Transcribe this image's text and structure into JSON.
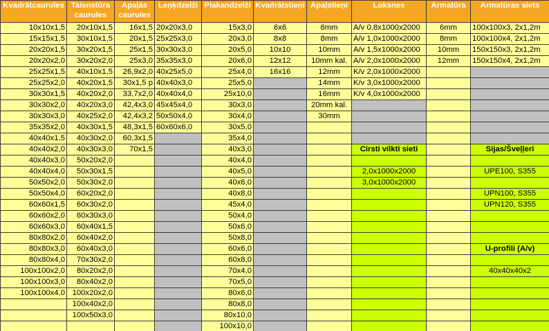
{
  "headers": [
    "Kvadrātcaurules",
    "Taisnstūra caurules",
    "Apaļās caurules",
    "Leņķdzelži",
    "Plakandzelži",
    "Kvadrātstieņi",
    "Apaļstieņi",
    "Loksnes",
    "Armatūra",
    "Armatūras siets"
  ],
  "colors": {
    "header": "#f5a623",
    "cell": "#ffff99",
    "empty": "#c0c0c0",
    "highlight": "#ccff00"
  },
  "rows": [
    [
      "10x10x1,5",
      "20x10x1,5",
      "16x1,5",
      "20x20x3,0",
      "15x3,0",
      "6x6",
      "6mm",
      "A/v 0,8x1000x2000",
      "6mm",
      "100x100x3, 2x1,2m"
    ],
    [
      "15x15x1,5",
      "30x10x1,5",
      "20x1,5",
      "25x25x3,0",
      "20x3,0",
      "8x8",
      "8mm",
      "A/v 1,0x1000x2000",
      "8mm",
      "100x100x4, 2x1,2m"
    ],
    [
      "20x20x1,5",
      "30x20x1,5",
      "25x1,5",
      "30x30x3,0",
      "20x5,0",
      "10x10",
      "10mm",
      "A/v 1,5x1000x2000",
      "10mm",
      "150x150x3, 2x1,2m"
    ],
    [
      "20x20x2,0",
      "30x20x2,0",
      "25x3,0",
      "35x35x3,0",
      "20x6,0",
      "12x12",
      "10mm kal.",
      "A/v 2,0x1000x2000",
      "12mm",
      "150x150x4, 2x1,2m"
    ],
    [
      "25x25x1,5",
      "40x10x1,5",
      "26,9x2,0",
      "40x25x5,0",
      "25x4,0",
      "16x16",
      "12mm",
      "K/v 2,0x1000x2000",
      "",
      ""
    ],
    [
      "25x25x2,0",
      "40x20x1,5",
      "30x1,5 p",
      "40x40x3,0",
      "25x5,0",
      "",
      "14mm",
      "K/v 3,0x1000x2000",
      "",
      ""
    ],
    [
      "30x30x1,5",
      "40x20x2,0",
      "33,7x2,0",
      "40x40x4,0",
      "25x10,0",
      "",
      "16mm",
      "K/v 4,0x1000x2000",
      "",
      ""
    ],
    [
      "30x30x2,0",
      "40x20x3,0",
      "42,4x3,0",
      "45x45x4,0",
      "30x3,0",
      "",
      "20mm kal.",
      "",
      "",
      ""
    ],
    [
      "30x30x3,0",
      "40x25x2,0",
      "42,4x3,2",
      "50x50x4,0",
      "30x4,0",
      "",
      "30mm",
      "",
      "",
      ""
    ],
    [
      "35x35x2,0",
      "40x30x1,5",
      "48,3x1,5",
      "60x60x6,0",
      "30x5,0",
      "",
      "",
      "",
      "",
      ""
    ],
    [
      "40x40x1,5",
      "40x30x2,0",
      "60,3x1,5",
      "",
      "35x4,0",
      "",
      "",
      "",
      "",
      ""
    ],
    [
      "40x40x2,0",
      "40x30x3,0",
      "70x1,5",
      "",
      "40x3,0",
      "",
      "",
      "Cirsti vilkti sieti",
      "",
      "Sijas/Šveļļeri"
    ],
    [
      "40x40x3,0",
      "50x20x2,0",
      "",
      "",
      "40x4,0",
      "",
      "",
      "",
      "",
      ""
    ],
    [
      "40x40x4,0",
      "50x30x1,5",
      "",
      "",
      "40x5,0",
      "",
      "",
      "2,0x1000x2000",
      "",
      "UPE100, S355"
    ],
    [
      "50x50x2,0",
      "50x30x2,0",
      "",
      "",
      "40x6,0",
      "",
      "",
      "3,0x1000x2000",
      "",
      ""
    ],
    [
      "50x50x4,0",
      "60x20x2,0",
      "",
      "",
      "40x8,0",
      "",
      "",
      "",
      "",
      "UPN100, S355"
    ],
    [
      "60x60x1,5",
      "60x30x2,0",
      "",
      "",
      "45x4,0",
      "",
      "",
      "",
      "",
      "UPN120, S355"
    ],
    [
      "60x60x2,0",
      "60x30x3,0",
      "",
      "",
      "50x4,0",
      "",
      "",
      "",
      "",
      ""
    ],
    [
      "60x60x3,0",
      "60x40x1,5",
      "",
      "",
      "50x6,0",
      "",
      "",
      "",
      "",
      ""
    ],
    [
      "80x80x2,0",
      "60x40x2,0",
      "",
      "",
      "50x8,0",
      "",
      "",
      "",
      "",
      ""
    ],
    [
      "80x80x3,0",
      "60x40x3,0",
      "",
      "",
      "60x6,0",
      "",
      "",
      "",
      "",
      "U-profili (A/v)"
    ],
    [
      "80x80x4,0",
      "70x30x2,0",
      "",
      "",
      "60x8,0",
      "",
      "",
      "",
      "",
      ""
    ],
    [
      "100x100x2,0",
      "80x20x2,0",
      "",
      "",
      "70x4,0",
      "",
      "",
      "",
      "",
      "40x40x40x2"
    ],
    [
      "100x100x3,0",
      "80x40x2,0",
      "",
      "",
      "70x5,0",
      "",
      "",
      "",
      "",
      ""
    ],
    [
      "100x100x4,0",
      "100x20x2,0",
      "",
      "",
      "80x6,0",
      "",
      "",
      "",
      "",
      ""
    ],
    [
      "",
      "100x40x2,0",
      "",
      "",
      "80x8,0",
      "",
      "",
      "",
      "",
      ""
    ],
    [
      "",
      "100x50x3,0",
      "",
      "",
      "80x10,0",
      "",
      "",
      "",
      "",
      ""
    ],
    [
      "",
      "",
      "",
      "",
      "100x10,0",
      "",
      "",
      "",
      "",
      ""
    ]
  ]
}
